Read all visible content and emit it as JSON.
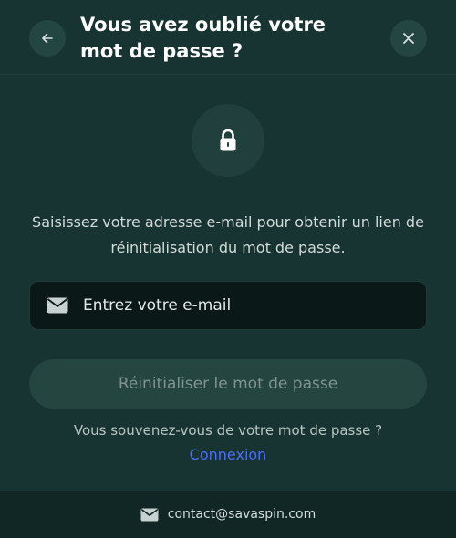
{
  "header": {
    "title": "Vous avez oublié votre mot de passe ?",
    "back_icon": "arrow-left-icon",
    "close_icon": "close-icon"
  },
  "hero": {
    "icon": "lock-icon"
  },
  "description": "Saisissez votre adresse e-mail pour obtenir un lien de réinitialisation du mot de passe.",
  "email": {
    "icon": "mail-icon",
    "placeholder": "Entrez votre e-mail",
    "value": ""
  },
  "reset_button": {
    "label": "Réinitialiser le mot de passe",
    "state": "disabled"
  },
  "remember": {
    "text": "Vous souvenez-vous de votre mot de passe ?",
    "login_label": "Connexion"
  },
  "footer": {
    "icon": "mail-icon",
    "contact": "contact@savaspin.com"
  },
  "colors": {
    "background": "#183432",
    "accent_link": "#4a6ff0",
    "input_background": "#0a1918",
    "disabled_button": "#254541"
  }
}
